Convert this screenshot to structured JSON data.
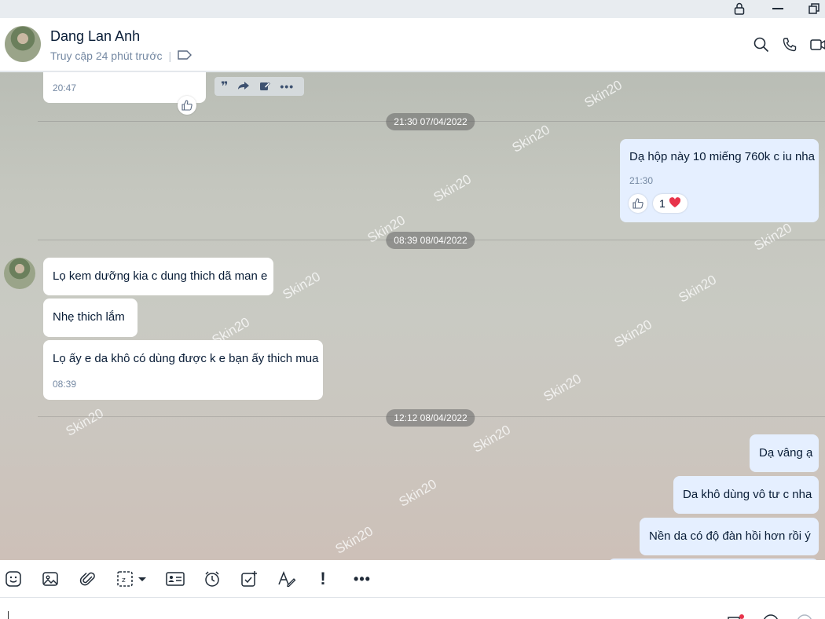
{
  "contact": {
    "name": "Dang Lan Anh",
    "status": "Truy cập 24 phút trước"
  },
  "watermark_text": "Skin20",
  "messages": {
    "m0_time": "20:47",
    "d1": "21:30 07/04/2022",
    "m1_text": "Dạ hộp này 10 miếng 760k c iu nha",
    "m1_time": "21:30",
    "m1_reaction_count": "1",
    "d2": "08:39 08/04/2022",
    "m2_text": "Lọ kem dưỡng kia c dung thich dã man e",
    "m3_text": "Nhẹ thich lắm",
    "m4_text": "Lọ ấy e da khô có dùng được k e bạn ấy thich mua",
    "m4_time": "08:39",
    "d3": "12:12 08/04/2022",
    "m5_text": "Dạ vâng ạ",
    "m6_text": "Da khô dùng vô tư c nha",
    "m7_text": "Nền da có độ đàn hồi hơn rồi ý"
  },
  "colors": {
    "header_bg": "#ffffff",
    "bubble_in": "#ffffff",
    "bubble_out": "#e5efff",
    "heart": "#e8334a",
    "accent_dot": "#e8334a"
  }
}
